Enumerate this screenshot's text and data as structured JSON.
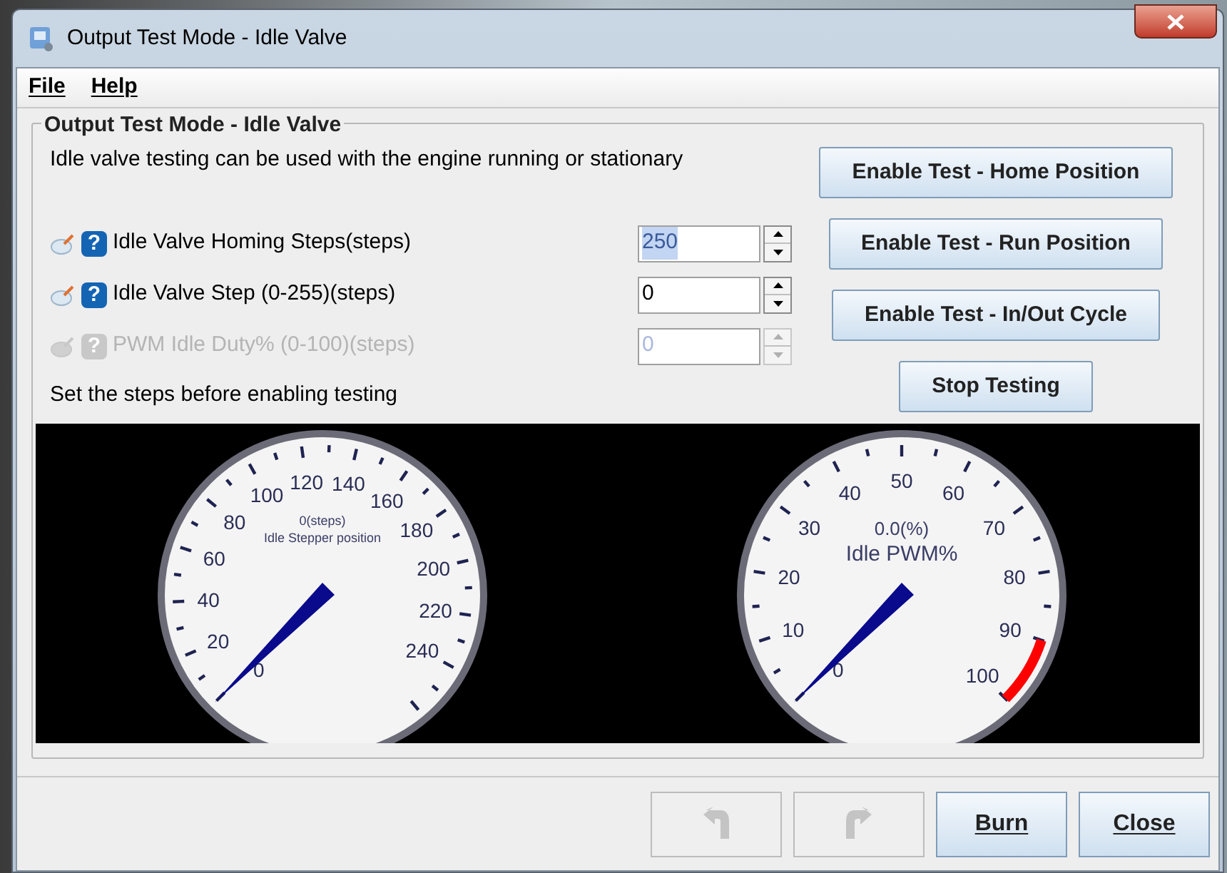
{
  "window": {
    "title": "Output Test Mode - Idle Valve"
  },
  "menu": [
    {
      "label": "File"
    },
    {
      "label": "Help"
    }
  ],
  "group": {
    "title": "Output Test Mode - Idle Valve",
    "intro": "Idle valve testing can be used with the engine running or stationary",
    "fields": [
      {
        "help": "?",
        "label": "Idle Valve Homing Steps(steps)",
        "value": "250",
        "disabled": false,
        "text_selected": true
      },
      {
        "help": "?",
        "label": "Idle Valve Step (0-255)(steps)",
        "value": "0",
        "disabled": false,
        "text_selected": false
      },
      {
        "help": "?",
        "label": "PWM Idle Duty% (0-100)(steps)",
        "value": "0",
        "disabled": true,
        "text_selected": false
      }
    ],
    "note": "Set the steps before enabling testing",
    "buttons": [
      "Enable Test - Home Position",
      "Enable Test - Run Position",
      "Enable Test - In/Out Cycle",
      "Stop Testing"
    ],
    "gauges": [
      {
        "kind": "steps",
        "reading": "0(steps)",
        "title": "Idle Stepper position",
        "scale_labels": [
          "0",
          "20",
          "40",
          "60",
          "80",
          "100",
          "120",
          "140",
          "160",
          "180",
          "200",
          "220",
          "240"
        ]
      },
      {
        "kind": "pwm",
        "reading": "0.0(%)",
        "title": "Idle PWM%",
        "scale_labels": [
          "0",
          "10",
          "20",
          "30",
          "40",
          "50",
          "60",
          "70",
          "80",
          "90",
          "100"
        ]
      }
    ]
  },
  "footer": {
    "buttons": [
      {
        "kind": "undo",
        "disabled": true
      },
      {
        "kind": "redo",
        "disabled": true
      },
      {
        "kind": "text",
        "label": "Burn",
        "disabled": false
      },
      {
        "kind": "text",
        "label": "Close",
        "disabled": false
      }
    ]
  }
}
